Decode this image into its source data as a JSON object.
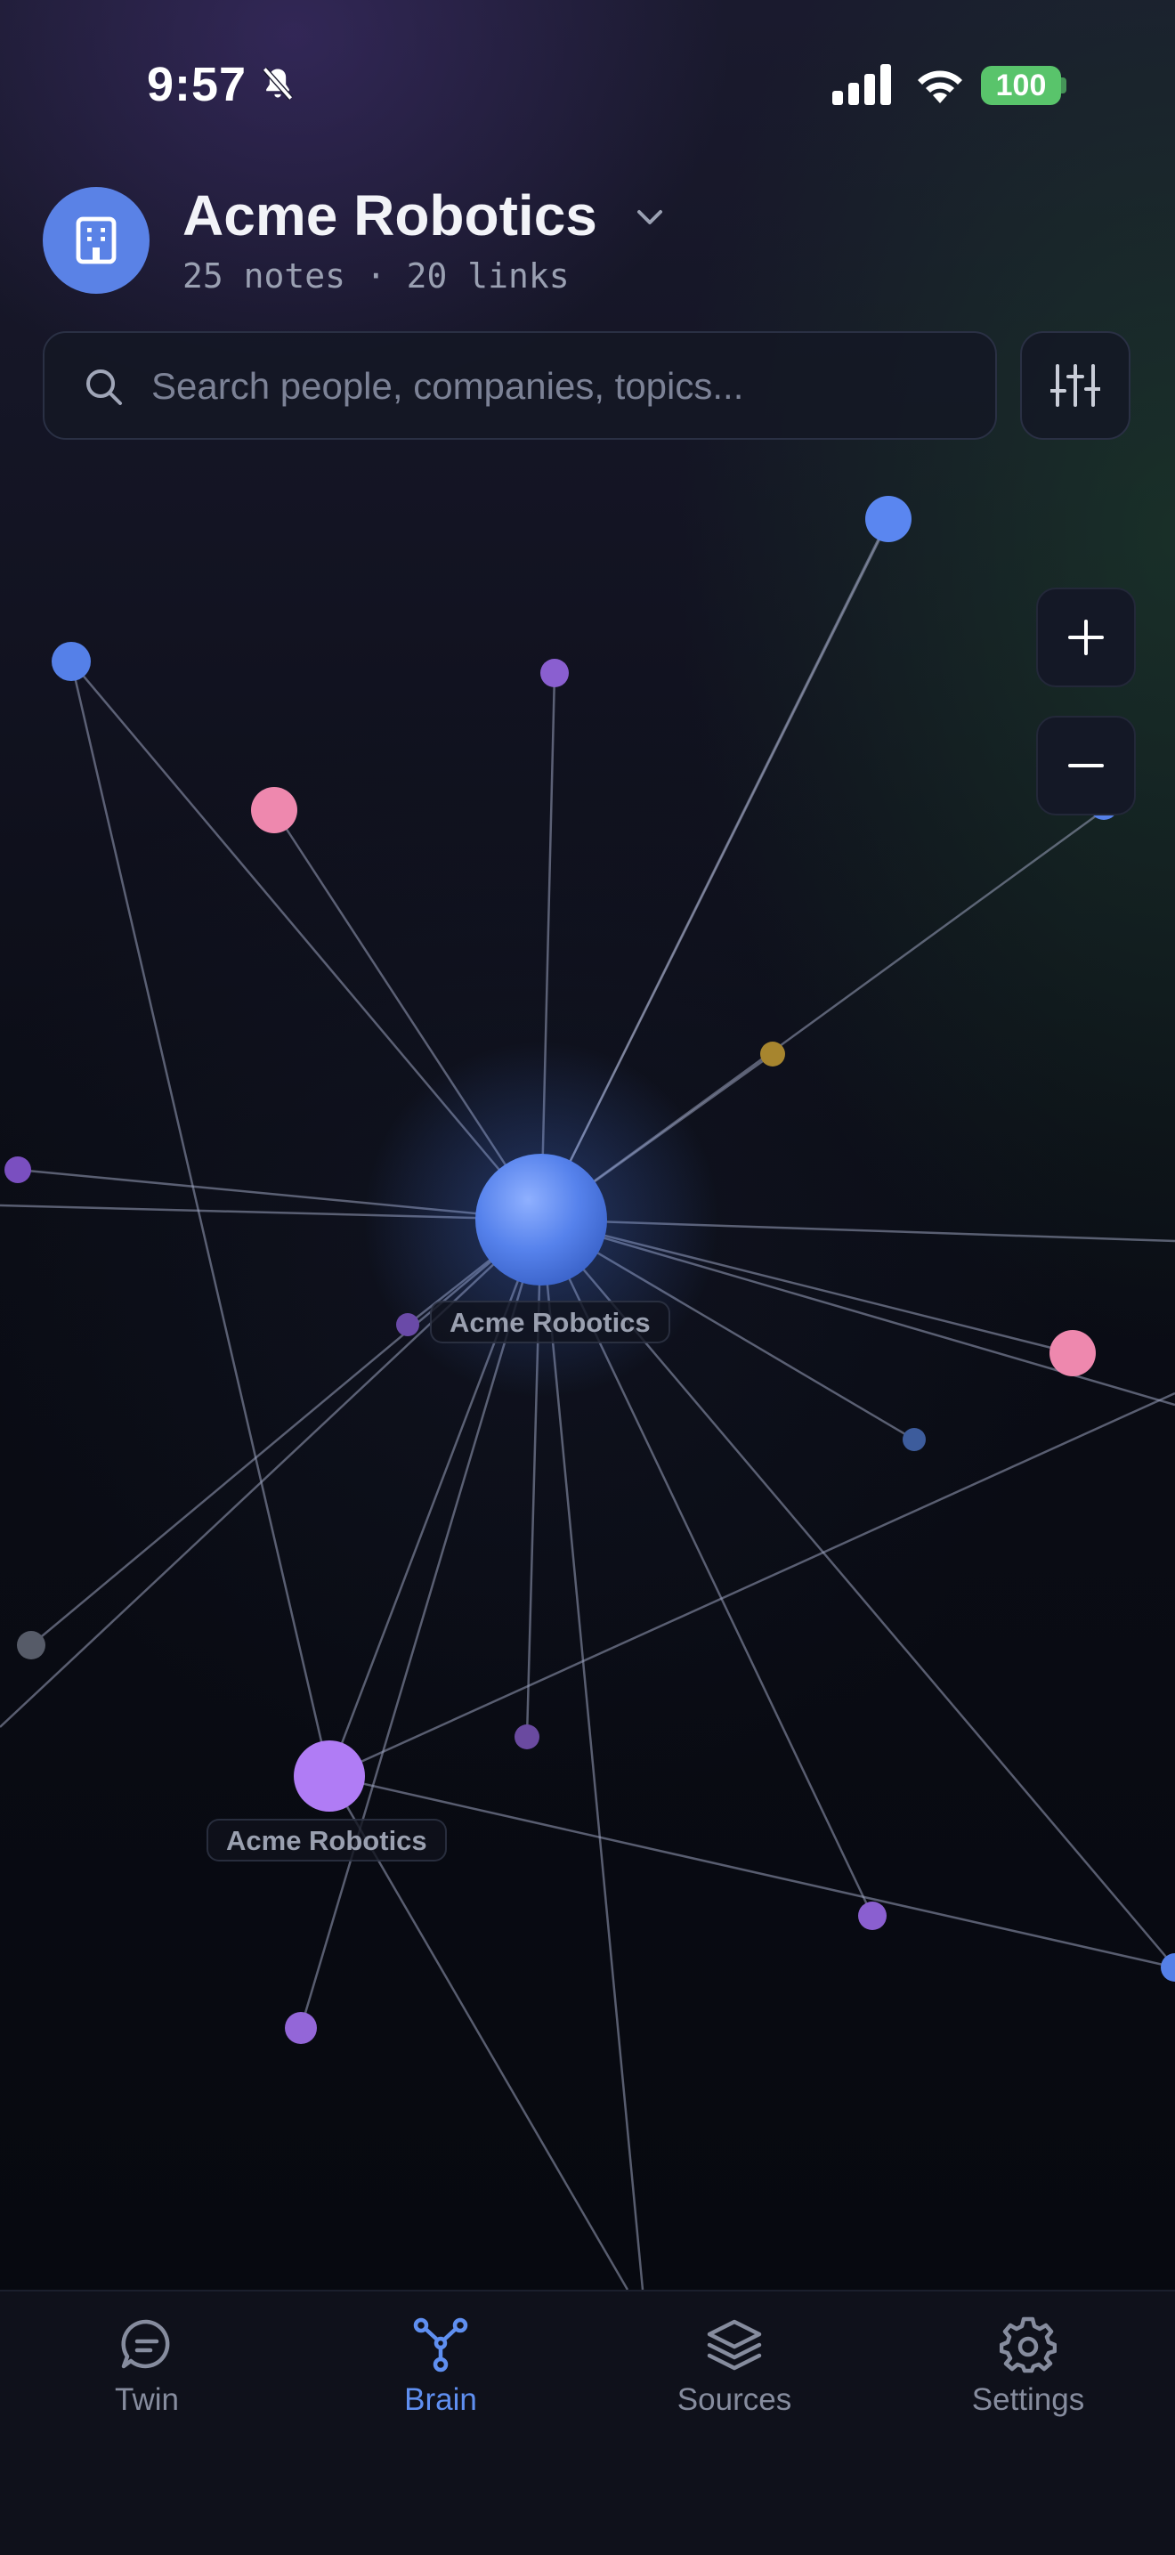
{
  "status_bar": {
    "time": "9:57",
    "battery": "100"
  },
  "header": {
    "workspace": "Acme Robotics",
    "stats": "25 notes · 20 links"
  },
  "search": {
    "placeholder": "Search people, companies, topics..."
  },
  "graph": {
    "labels": [
      "Acme Robotics",
      "Acme Robotics"
    ]
  },
  "tabs": [
    {
      "label": "Twin",
      "icon": "chat-bubble-icon",
      "active": false
    },
    {
      "label": "Brain",
      "icon": "graph-nodes-icon",
      "active": true
    },
    {
      "label": "Sources",
      "icon": "layers-icon",
      "active": false
    },
    {
      "label": "Settings",
      "icon": "gear-icon",
      "active": false
    }
  ],
  "colors": {
    "accent": "#5f8ff0",
    "node_blue": "#5a86f0",
    "node_purple": "#9366d8",
    "node_pink": "#ee88ae",
    "node_gold": "#b08a30",
    "node_gray": "#5a5f6e",
    "node_violet": "#b07cf5"
  }
}
